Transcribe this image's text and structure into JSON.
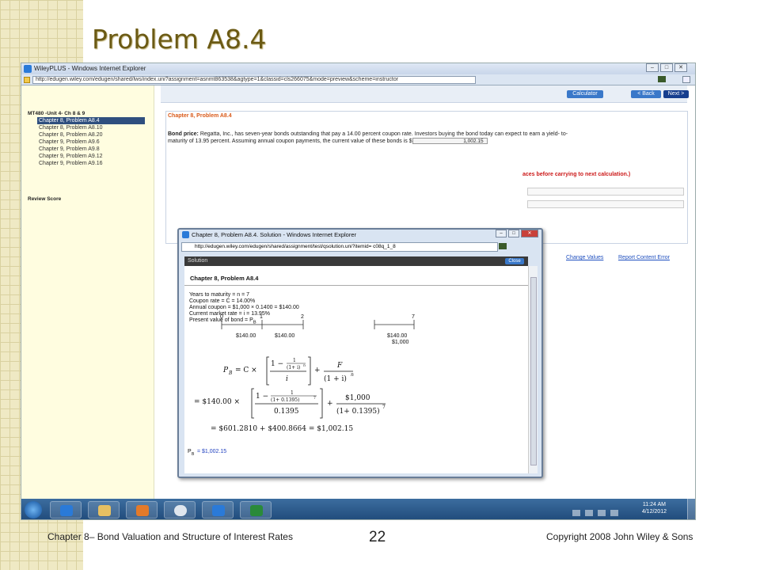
{
  "slide": {
    "title": "Problem A8.4",
    "footer_left": "Chapter 8– Bond Valuation and Structure of Interest Rates",
    "page_number": "22",
    "footer_right": "Copyright 2008 John Wiley & Sons"
  },
  "browser": {
    "title": "WileyPLUS - Windows Internet Explorer",
    "url": "http://edugen.wiley.com/edugen/shared/lws/index.uni?assignment=asnmt863538&agtype=1&classid=cls266075&mode=preview&scheme=instructor"
  },
  "sidebar": {
    "course": "MT480 -Unit 4- Ch 8 & 9",
    "items": [
      "Chapter 8, Problem A8.4",
      "Chapter 8, Problem A8.10",
      "Chapter 8, Problem A8.20",
      "Chapter 9, Problem A9.6",
      "Chapter 9, Problem A9.8",
      "Chapter 9, Problem A9.12",
      "Chapter 9, Problem A9.16"
    ],
    "review": "Review Score"
  },
  "toolbar": {
    "calculator": "Calculator",
    "back": "< Back",
    "next": "Next >"
  },
  "problem": {
    "heading": "Chapter 8, Problem A8.4",
    "label": "Bond price:",
    "text1": " Regatta, Inc., has seven-year bonds outstanding that pay a 14.00 percent coupon rate. Investors buying the bond today can expect to earn a yield- to-",
    "text2": "maturity of 13.95 percent. Assuming annual coupon payments, the current value of these bonds is $",
    "answer": "1,002.15",
    "note": "aces before carrying to next calculation.)",
    "change_values": "Change Values",
    "report_error": "Report Content Error"
  },
  "popup": {
    "title": "Chapter 8, Problem A8.4. Solution - Windows Internet Explorer",
    "url": "http://edugen.wiley.com/edugen/shared/assignment/test/qsolution.uni?itemid= c08q_1_8",
    "bar": "Solution",
    "close": "Close",
    "heading": "Chapter 8, Problem A8.4",
    "givens": [
      "Years to maturity = n = 7",
      "Coupon rate = C = 14.00%",
      "Annual coupon = $1,000 × 0.1400 = $140.00",
      "Current market rate = i = 13.95%",
      "Present value of bond = P"
    ],
    "timeline": {
      "t0": "0",
      "t1": "1",
      "t2": "2",
      "t7": "7",
      "c1": "$140.00",
      "c2": "$140.00",
      "c7a": "$140.00",
      "c7b": "$1,000"
    },
    "formula": {
      "pb": "P",
      "eq1": "= C ×",
      "one": "1 −",
      "num1": "1",
      "den1": "(1+ i)",
      "n": "n",
      "i": "i",
      "plus": "+",
      "f": "F",
      "den2": "(1 + i)",
      "eq2": "= $140.00 ×",
      "den1b": "(1+ 0.1395)",
      "seven": "7",
      "i_val": "0.1395",
      "f_val": "$1,000",
      "den2b": "(1+ 0.1395)",
      "result": "= $601.2810 + $400.8664 = $1,002.15"
    },
    "final_label": "P",
    "final_value": "= $1,002.15",
    "sub_b": "B"
  },
  "taskbar": {
    "time": "11:24 AM",
    "date": "4/12/2012"
  }
}
